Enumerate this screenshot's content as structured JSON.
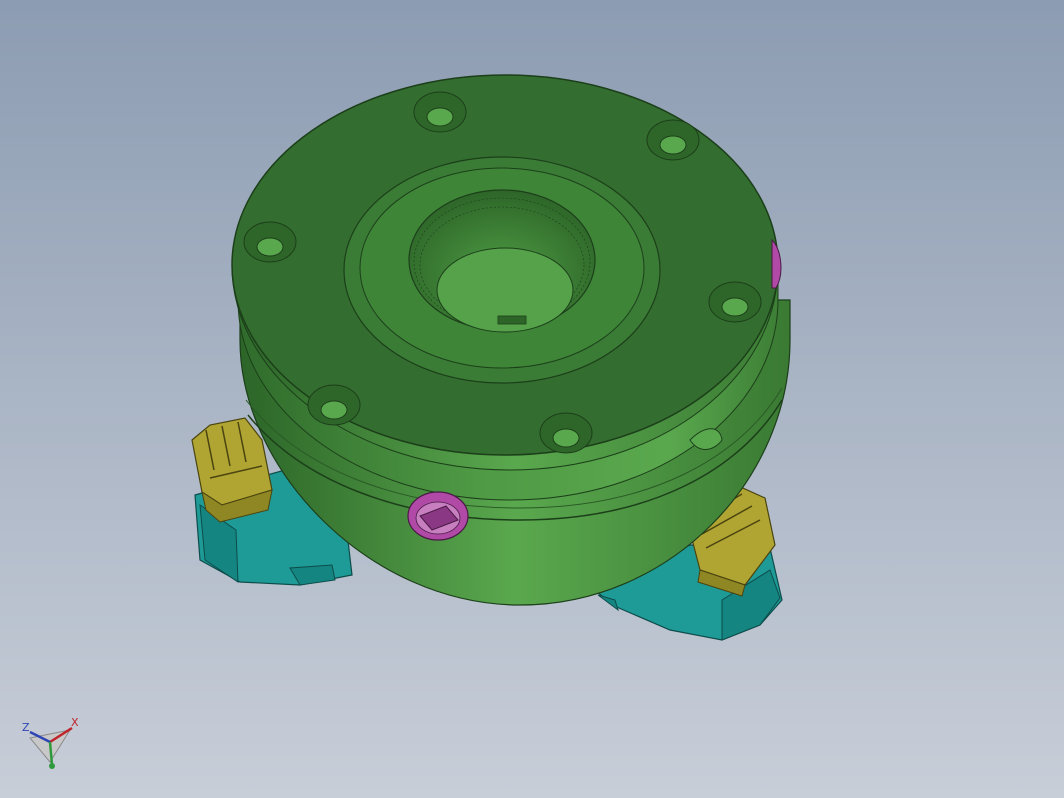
{
  "viewport": {
    "background_top": "#8d9db2",
    "background_bottom": "#c6ccd6"
  },
  "model": {
    "parts": [
      {
        "name": "chuck-body",
        "color": "#3f8a3a"
      },
      {
        "name": "jaw-top",
        "color": "#a8a02e"
      },
      {
        "name": "jaw-base",
        "color": "#1e9a96"
      },
      {
        "name": "key-socket",
        "color": "#b04aa6"
      }
    ]
  },
  "triad": {
    "x_label": "X",
    "z_label": "Z",
    "x_color": "#c0242b",
    "y_color": "#2e9a3c",
    "z_color": "#2f45b4"
  }
}
